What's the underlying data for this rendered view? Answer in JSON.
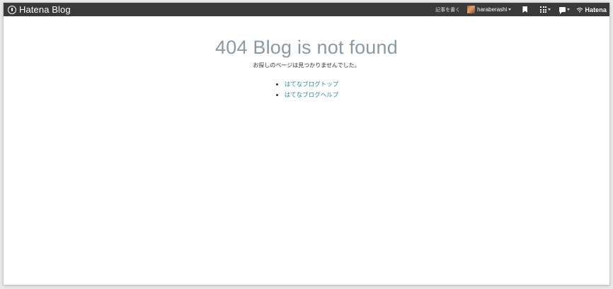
{
  "topbar": {
    "logo_text": "Hatena Blog",
    "write_label": "記事を書く",
    "username": "haraberashi",
    "brand_text": "Hatena"
  },
  "main": {
    "title": "404 Blog is not found",
    "message": "お探しのページは見つかりませんでした。",
    "links": [
      {
        "label": "はてなブログトップ"
      },
      {
        "label": "はてなブログヘルプ"
      }
    ]
  },
  "colors": {
    "topbar_bg": "#3a3a3a",
    "title": "#8b99a3",
    "link": "#2f8ab8"
  }
}
